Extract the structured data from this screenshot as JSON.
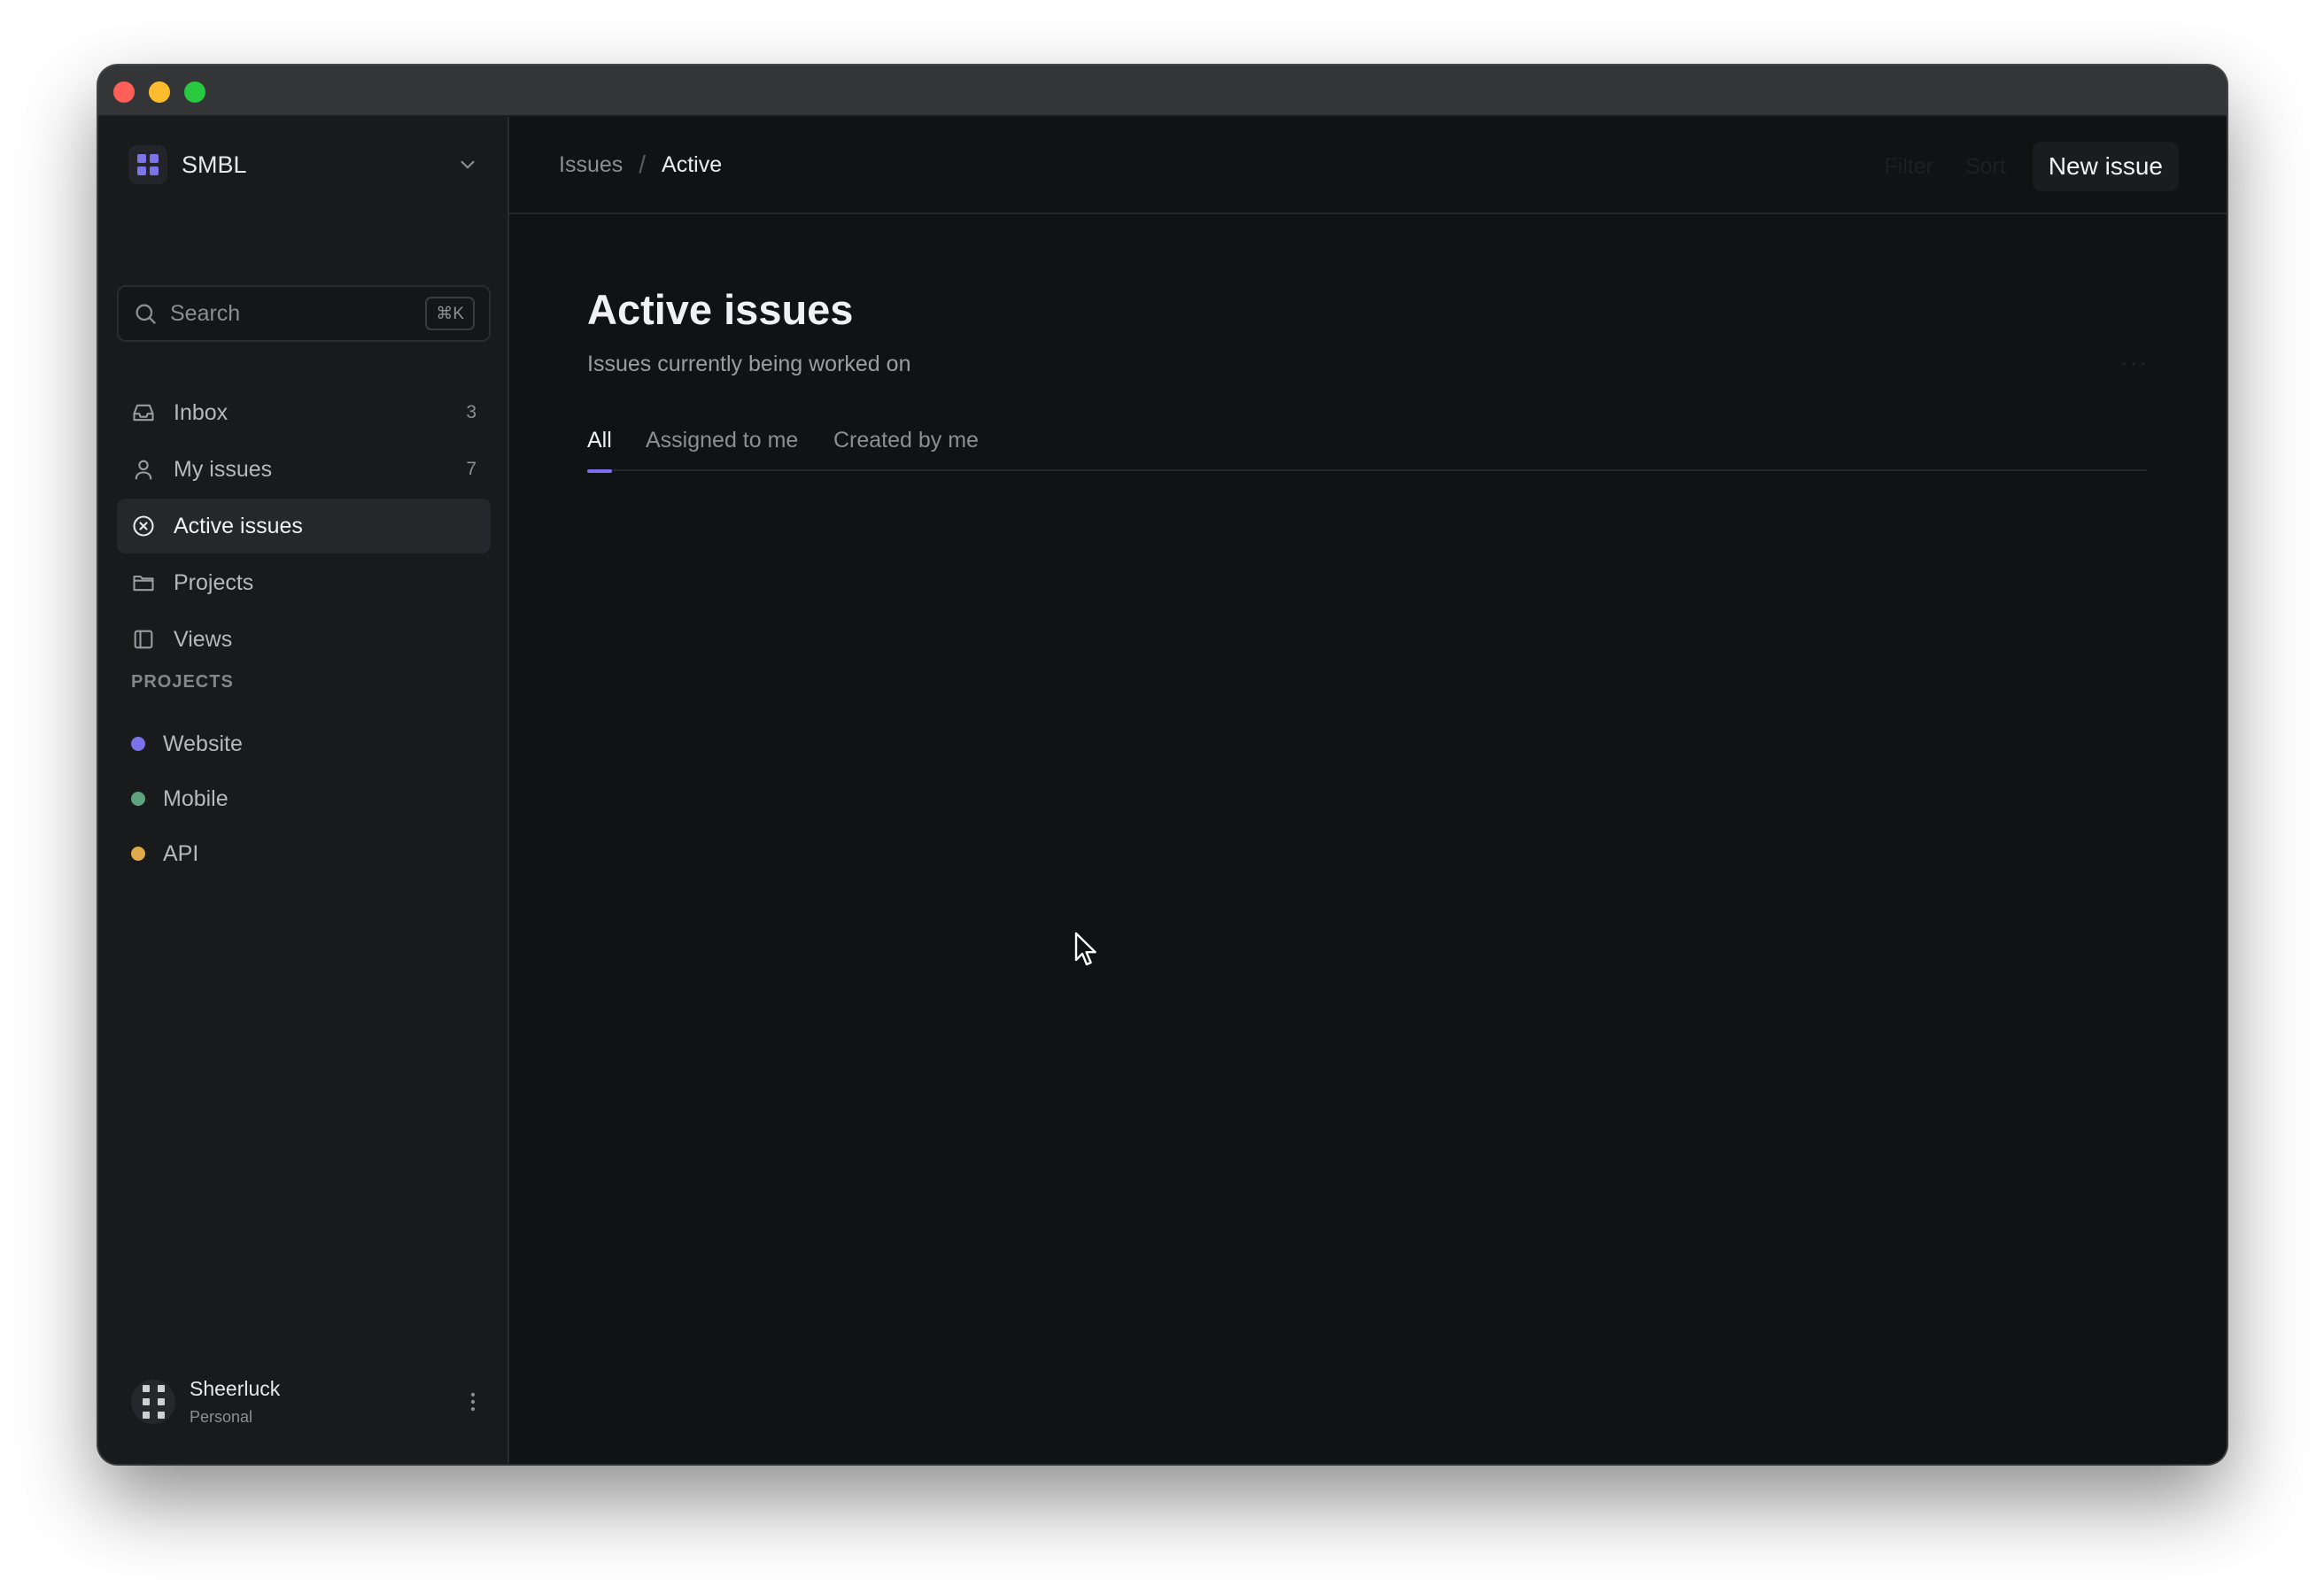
{
  "workspace": {
    "name": "SMBL"
  },
  "search": {
    "placeholder": "Search",
    "shortcut": "⌘K"
  },
  "sidebar": {
    "items": [
      {
        "label": "Inbox",
        "count": "3",
        "icon": "inbox-icon"
      },
      {
        "label": "My issues",
        "count": "7",
        "icon": "user-icon"
      },
      {
        "label": "Active issues",
        "count": "",
        "icon": "x-circle-icon",
        "active": true
      },
      {
        "label": "Projects",
        "count": "",
        "icon": "folder-icon"
      },
      {
        "label": "Views",
        "count": "",
        "icon": "layout-icon"
      }
    ],
    "projects_label": "PROJECTS",
    "projects": [
      {
        "label": "Website",
        "color": "#7b72e9"
      },
      {
        "label": "Mobile",
        "color": "#5fa37e"
      },
      {
        "label": "API",
        "color": "#e0a94a"
      }
    ]
  },
  "user": {
    "name": "Sheerluck",
    "plan": "Personal"
  },
  "header": {
    "breadcrumb_parent": "Issues",
    "breadcrumb_separator": "/",
    "breadcrumb_current": "Active",
    "filter_label": "Filter",
    "sort_label": "Sort",
    "new_issue_label": "New issue"
  },
  "page": {
    "title": "Active issues",
    "subtitle": "Issues currently being worked on",
    "more_label": "···"
  },
  "tabs": [
    {
      "label": "All",
      "active": true
    },
    {
      "label": "Assigned to me",
      "active": false
    },
    {
      "label": "Created by me",
      "active": false
    }
  ],
  "colors": {
    "accent": "#7c6ff0",
    "background": "#111214",
    "sidebar": "#191a1c"
  }
}
